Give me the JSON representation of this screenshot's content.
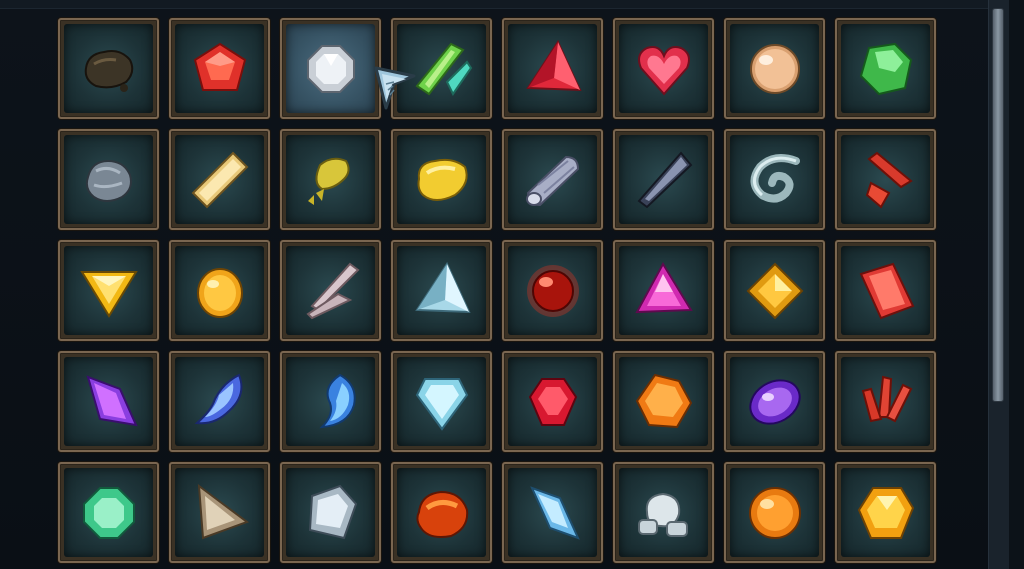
{
  "inventory": {
    "selected_index": 2,
    "slots": [
      {
        "icon": "dark-ore-icon"
      },
      {
        "icon": "red-pentagon-gem-icon"
      },
      {
        "icon": "white-diamond-gem-icon"
      },
      {
        "icon": "green-shard-icon"
      },
      {
        "icon": "red-pyramid-gem-icon"
      },
      {
        "icon": "red-heart-gem-icon"
      },
      {
        "icon": "amber-pearl-icon"
      },
      {
        "icon": "green-crystal-icon"
      },
      {
        "icon": "grey-ore-icon"
      },
      {
        "icon": "gold-crystal-icon"
      },
      {
        "icon": "yellow-ore-chunk-icon"
      },
      {
        "icon": "yellow-nugget-icon"
      },
      {
        "icon": "grey-log-icon"
      },
      {
        "icon": "dark-blade-shard-icon"
      },
      {
        "icon": "spiral-horn-icon"
      },
      {
        "icon": "red-shards-icon"
      },
      {
        "icon": "yellow-triangle-gem-icon"
      },
      {
        "icon": "amber-egg-icon"
      },
      {
        "icon": "pale-shards-icon"
      },
      {
        "icon": "pale-blue-pyramid-icon"
      },
      {
        "icon": "red-orb-icon"
      },
      {
        "icon": "magenta-triangle-gem-icon"
      },
      {
        "icon": "topaz-square-gem-icon"
      },
      {
        "icon": "red-rhombus-gem-icon"
      },
      {
        "icon": "violet-crystal-icon"
      },
      {
        "icon": "blue-flame-gem-icon"
      },
      {
        "icon": "blue-swirl-gem-icon"
      },
      {
        "icon": "ice-shield-gem-icon"
      },
      {
        "icon": "ruby-gem-icon"
      },
      {
        "icon": "orange-faceted-gem-icon"
      },
      {
        "icon": "amethyst-oval-icon"
      },
      {
        "icon": "red-crystal-cluster-icon"
      },
      {
        "icon": "green-octagon-gem-icon"
      },
      {
        "icon": "brown-triangle-gem-icon"
      },
      {
        "icon": "silver-shield-gem-icon"
      },
      {
        "icon": "orange-ore-icon"
      },
      {
        "icon": "blue-diamond-crystal-icon"
      },
      {
        "icon": "white-stones-icon"
      },
      {
        "icon": "orange-sphere-icon"
      },
      {
        "icon": "gold-faceted-gem-icon"
      }
    ]
  },
  "colors": {
    "frame": "#7a6650",
    "slot_bg": "#1d3338",
    "selected_bg": "#385566"
  }
}
